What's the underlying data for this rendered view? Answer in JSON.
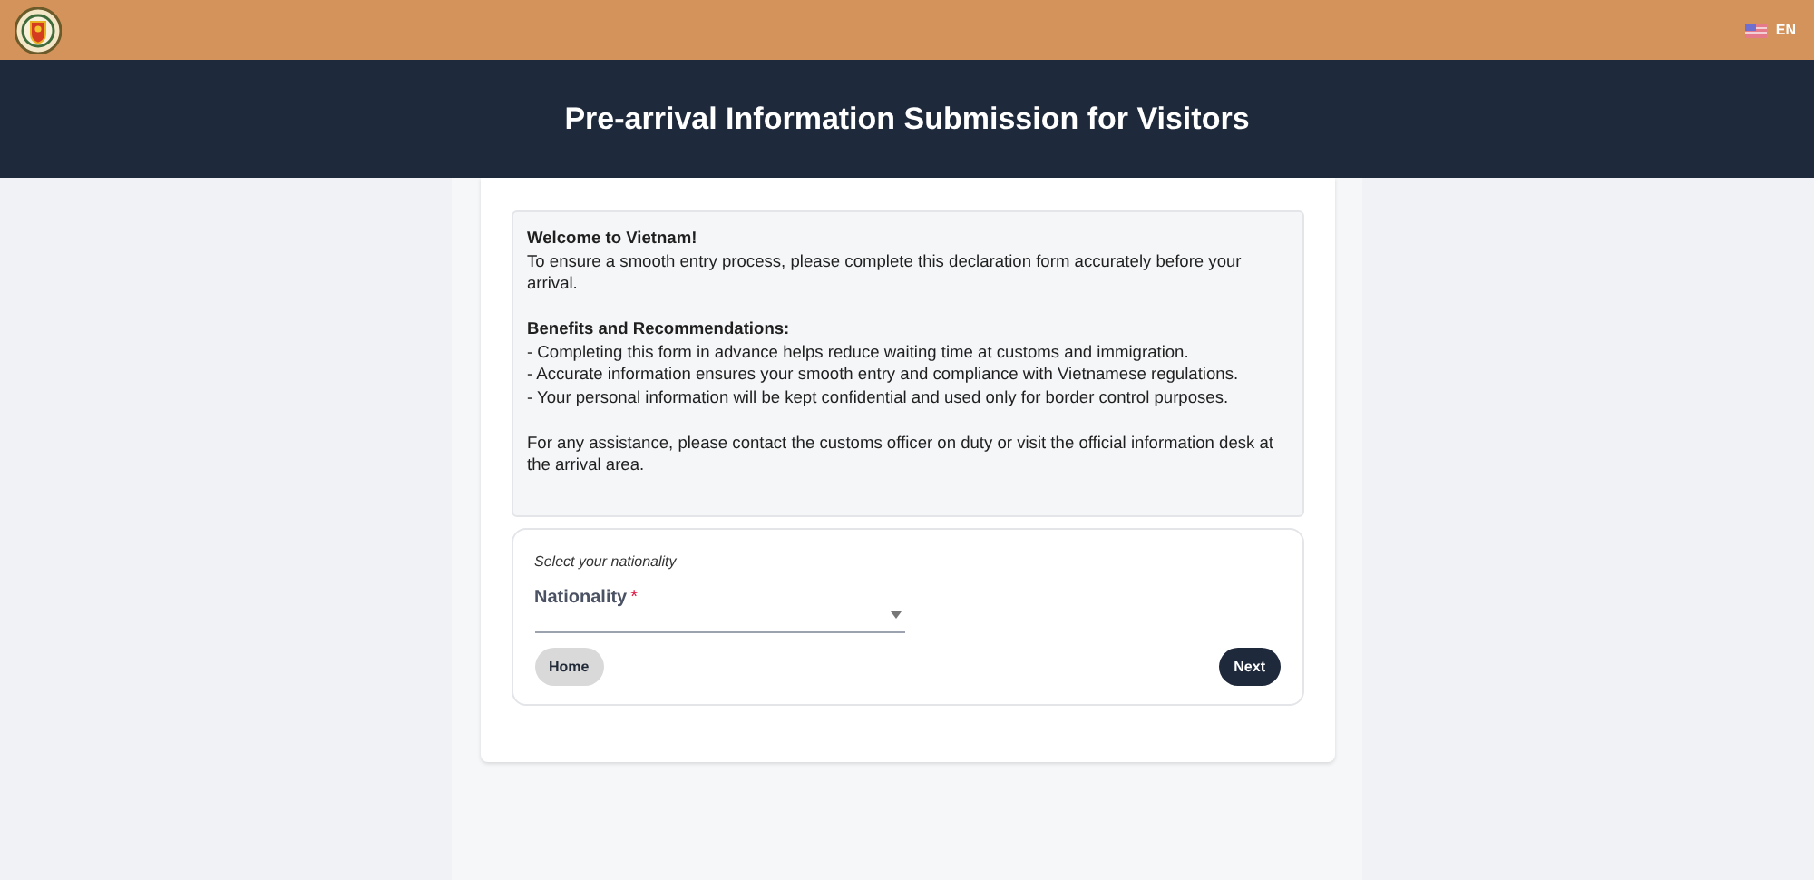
{
  "top_bar": {
    "language": "EN"
  },
  "header": {
    "title": "Pre-arrival Information Submission for Visitors"
  },
  "info": {
    "welcome_title": "Welcome to Vietnam!",
    "welcome_text": "To ensure a smooth entry process, please complete this declaration form accurately before your arrival.",
    "benefits_title": "Benefits and Recommendations:",
    "benefits": [
      "- Completing this form in advance helps reduce waiting time at customs and immigration.",
      "- Accurate information ensures your smooth entry and compliance with Vietnamese regulations.",
      "- Your personal information will be kept confidential and used only for border control purposes."
    ],
    "assistance": "For any assistance, please contact the customs officer on duty or visit the official information desk at the arrival area."
  },
  "form": {
    "hint": "Select your nationality",
    "field": {
      "label": "Nationality",
      "required": true,
      "required_mark": "*"
    },
    "buttons": [
      {
        "label": "Home",
        "kind": "secondary"
      },
      {
        "label": "Next",
        "kind": "primary"
      }
    ]
  }
}
